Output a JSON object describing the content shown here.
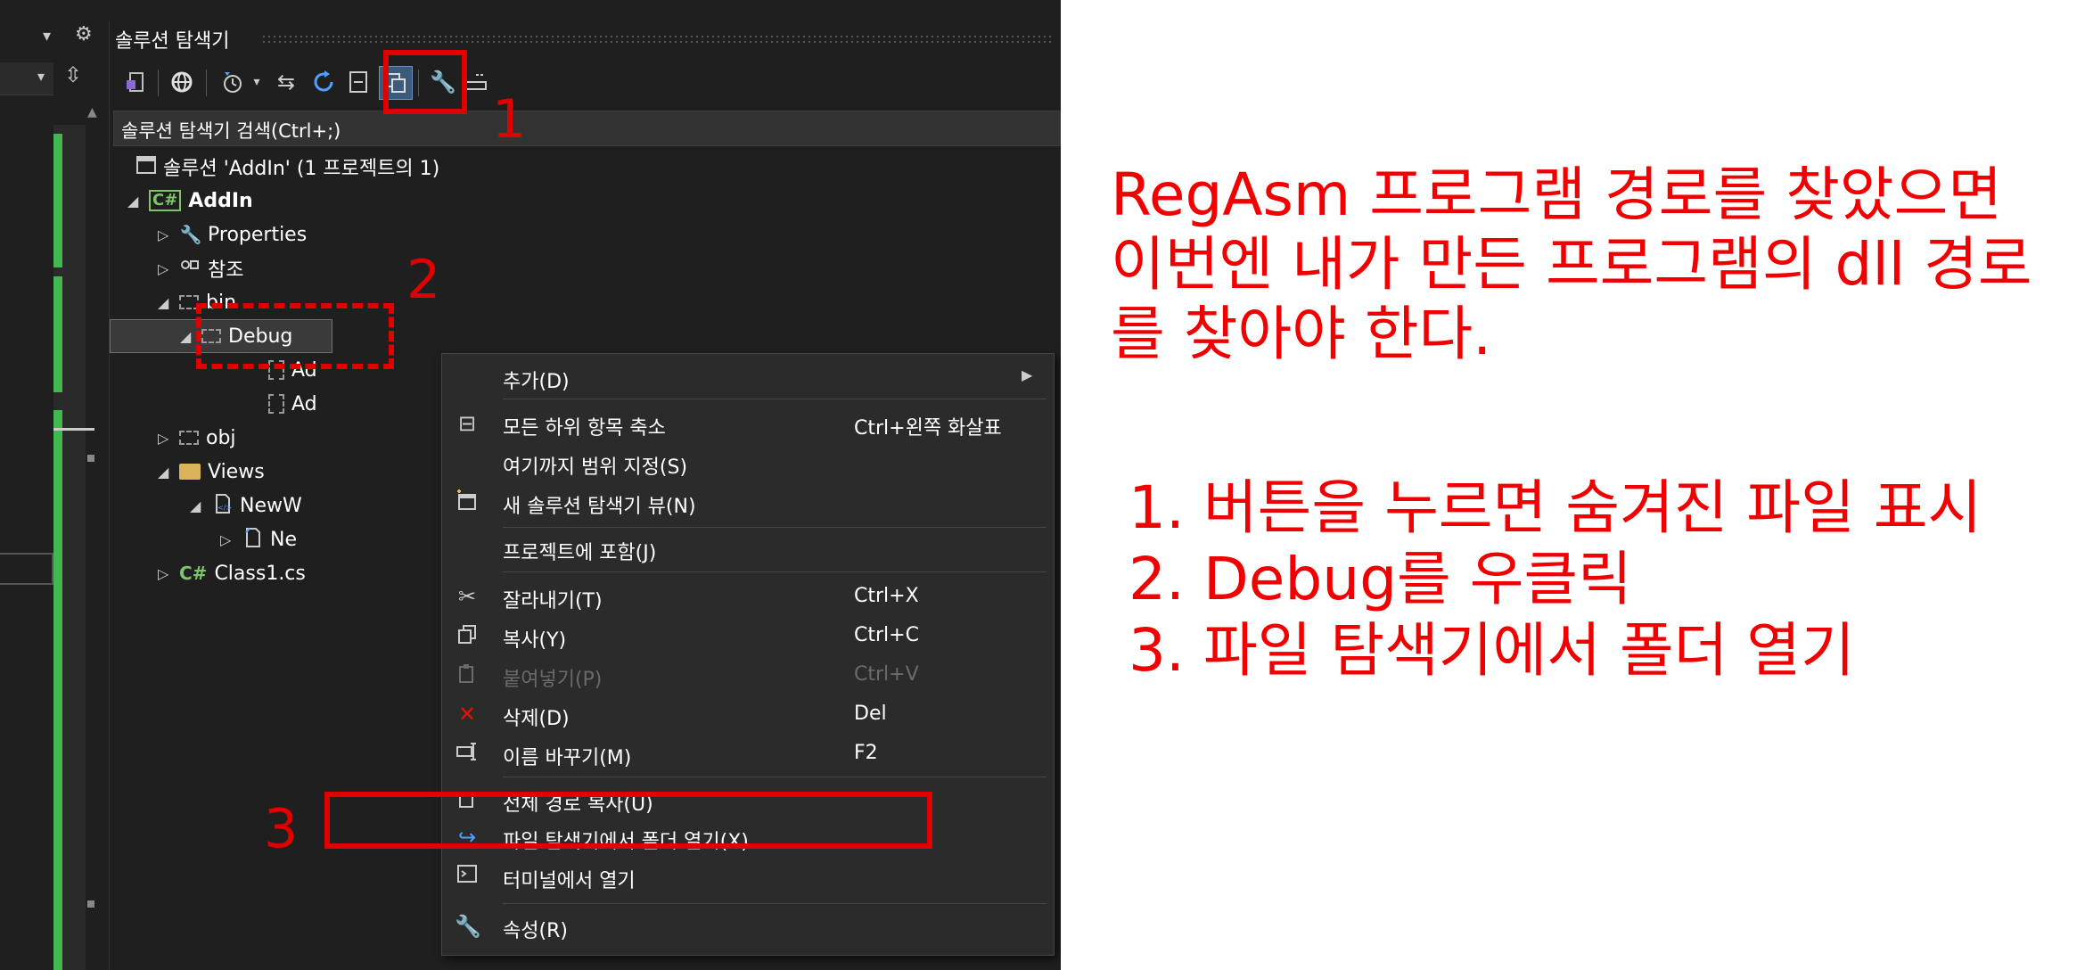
{
  "solution_explorer": {
    "title": "솔루션 탐색기",
    "search_placeholder": "솔루션 탐색기 검색(Ctrl+;)",
    "tree": {
      "solution": "솔루션 'AddIn' (1 프로젝트의 1)",
      "project": "AddIn",
      "properties": "Properties",
      "references": "참조",
      "bin": "bin",
      "debug": "Debug",
      "debug_child1": "Ad",
      "debug_child2": "Ad",
      "obj": "obj",
      "views": "Views",
      "views_child": "NewW",
      "views_grandchild": "Ne",
      "class1": "Class1.cs"
    }
  },
  "context_menu": {
    "add": "추가(D)",
    "collapse_all": "모든 하위 항목 축소",
    "collapse_all_shortcut": "Ctrl+왼쪽 화살표",
    "scope_to_this": "여기까지 범위 지정(S)",
    "new_view": "새 솔루션 탐색기 뷰(N)",
    "include_in_project": "프로젝트에 포함(J)",
    "cut": "잘라내기(T)",
    "cut_shortcut": "Ctrl+X",
    "copy": "복사(Y)",
    "copy_shortcut": "Ctrl+C",
    "paste": "붙여넣기(P)",
    "paste_shortcut": "Ctrl+V",
    "delete": "삭제(D)",
    "delete_shortcut": "Del",
    "rename": "이름 바꾸기(M)",
    "rename_shortcut": "F2",
    "copy_full_path": "전체 경로 복사(U)",
    "open_in_explorer": "파일 탐색기에서 폴더 열기(X)",
    "open_in_terminal": "터미널에서 열기",
    "properties": "속성(R)"
  },
  "annotations": {
    "marker_1": "1",
    "marker_2": "2",
    "marker_3": "3",
    "note_line1": "RegAsm 프로그램 경로를 찾았으면",
    "note_line2": "이번엔 내가 만든 프로그램의 dll 경로",
    "note_line3": "를 찾아야 한다.",
    "step1": "1. 버튼을 누르면 숨겨진 파일 표시",
    "step2": "2. Debug를 우클릭",
    "step3": "3. 파일 탐색기에서 폴더 열기"
  },
  "colors": {
    "annotation_red": "#e00000",
    "vs_background": "#1f1f1f",
    "menu_background": "#2b2b2b",
    "csharp_green": "#7ec26b"
  },
  "icons": {
    "toolbar": [
      "switch-views-icon",
      "globe-icon",
      "history-icon",
      "sync-icon",
      "refresh-icon",
      "collapse-icon",
      "show-all-files-icon",
      "wrench-icon",
      "preview-icon"
    ]
  }
}
